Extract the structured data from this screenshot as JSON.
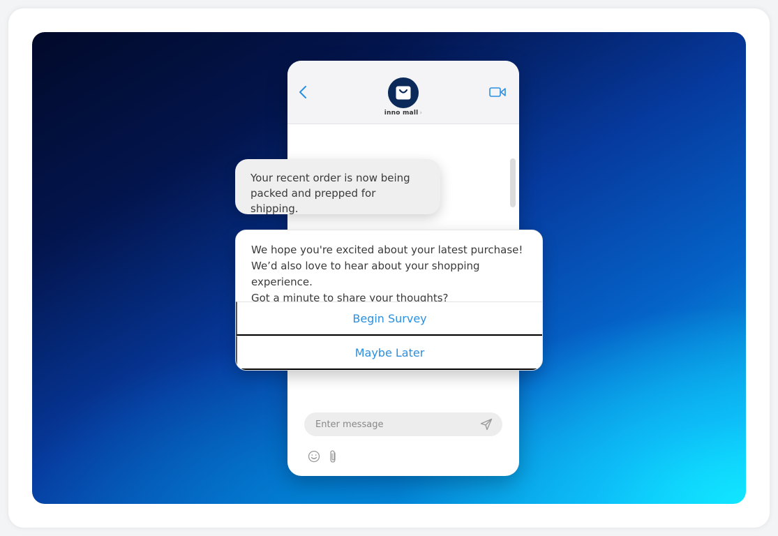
{
  "chat": {
    "brand_name": "inno mall",
    "brand_chevron": "›",
    "composer_placeholder": "Enter message",
    "messages": {
      "order_update": "Your recent order is now being packed and prepped for shipping.",
      "survey_line_1": "We hope you're excited about your latest purchase!",
      "survey_line_2": "We’d also love to hear about your shopping experience.",
      "survey_line_3": "Got a minute to share your thoughts?"
    },
    "options": {
      "begin": "Begin Survey",
      "later": "Maybe Later"
    }
  },
  "colors": {
    "accent_blue": "#2b8fe0",
    "avatar_navy": "#0b2a5a",
    "icon_grey": "#9a9a9a"
  },
  "icons": {
    "back": "chevron-left-icon",
    "video": "video-camera-icon",
    "avatar": "shopping-bag-icon",
    "send": "paper-plane-icon",
    "emoji": "smiley-icon",
    "attach": "paperclip-icon"
  }
}
